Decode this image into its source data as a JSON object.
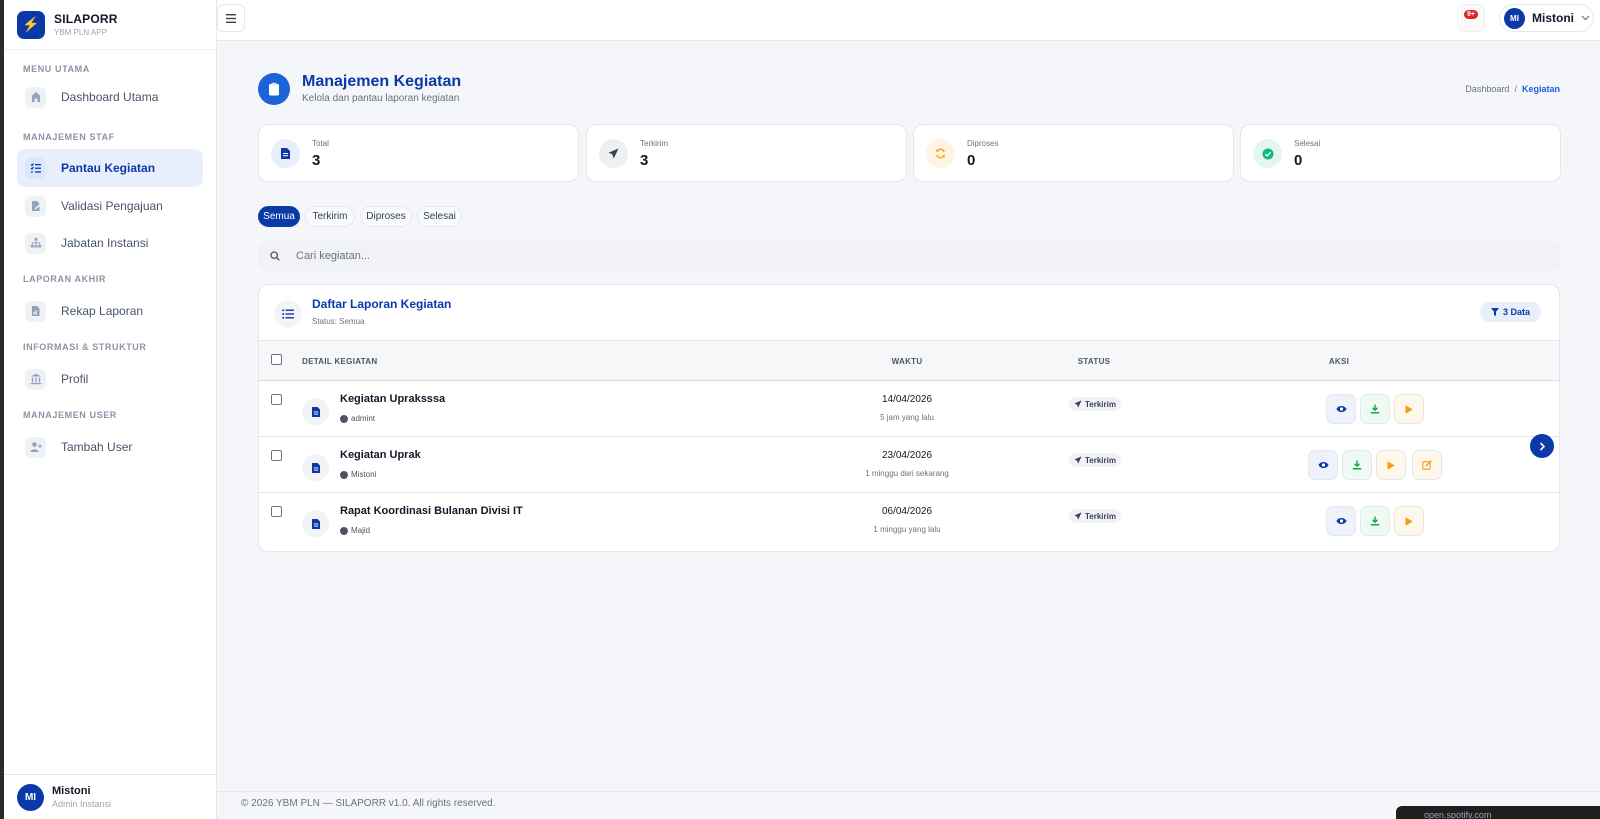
{
  "brand": {
    "title": "SILAPORR",
    "subtitle": "YBM PLN APP"
  },
  "sidebar": {
    "sections": [
      "MENU UTAMA",
      "MANAJEMEN STAF",
      "LAPORAN AKHIR",
      "INFORMASI & STRUKTUR",
      "MANAJEMEN USER"
    ],
    "items": [
      {
        "label": "Dashboard Utama",
        "icon": "home-icon",
        "active": false
      },
      {
        "label": "Pantau Kegiatan",
        "icon": "list-check-icon",
        "active": true
      },
      {
        "label": "Validasi Pengajuan",
        "icon": "file-signature-icon",
        "active": false
      },
      {
        "label": "Jabatan Instansi",
        "icon": "sitemap-icon",
        "active": false
      },
      {
        "label": "Rekap Laporan",
        "icon": "file-chart-icon",
        "active": false
      },
      {
        "label": "Profil",
        "icon": "building-columns-icon",
        "active": false
      },
      {
        "label": "Tambah User",
        "icon": "user-plus-icon",
        "active": false
      }
    ]
  },
  "user": {
    "initials": "MI",
    "name": "Mistoni",
    "role": "Admin Instansi"
  },
  "topbar": {
    "notification_badge": "9+",
    "user_initials": "MI",
    "user_name": "Mistoni"
  },
  "page": {
    "title": "Manajemen Kegiatan",
    "subtitle": "Kelola dan pantau laporan kegiatan",
    "breadcrumb": [
      "Dashboard",
      "Kegiatan"
    ]
  },
  "stats": [
    {
      "label": "Total",
      "value": "3",
      "icon": "file-icon",
      "color": "#0b3aa8"
    },
    {
      "label": "Terkirim",
      "value": "3",
      "icon": "paper-plane-icon",
      "color": "#374151"
    },
    {
      "label": "Diproses",
      "value": "0",
      "icon": "sync-icon",
      "color": "#f59e0b"
    },
    {
      "label": "Selesai",
      "value": "0",
      "icon": "check-circle-icon",
      "color": "#10b981"
    }
  ],
  "tabs": [
    "Semua",
    "Terkirim",
    "Diproses",
    "Selesai"
  ],
  "search": {
    "placeholder": "Cari kegiatan..."
  },
  "table": {
    "title": "Daftar Laporan Kegiatan",
    "subtitle": "Status: Semua",
    "count_label": "3 Data",
    "columns": [
      "DETAIL KEGIATAN",
      "WAKTU",
      "STATUS",
      "AKSI"
    ],
    "rows": [
      {
        "title": "Kegiatan Upraksssa",
        "author": "admint",
        "date": "14/04/2026",
        "relative": "5 jam yang lalu",
        "status": "Terkirim"
      },
      {
        "title": "Kegiatan Uprak",
        "author": "Mistoni",
        "date": "23/04/2026",
        "relative": "1 minggu dari sekarang",
        "status": "Terkirim"
      },
      {
        "title": "Rapat Koordinasi Bulanan Divisi IT",
        "author": "Majid",
        "date": "06/04/2026",
        "relative": "1 minggu yang lalu",
        "status": "Terkirim"
      }
    ]
  },
  "footer": {
    "text": "© 2026 YBM PLN — SILAPORR v1.0. All rights reserved."
  },
  "popup": {
    "text": "open.spotify.com"
  },
  "colors": {
    "primary": "#0b3aa8",
    "accent": "#1d63d8",
    "success": "#10b981",
    "warning": "#f59e0b",
    "danger": "#dc2626"
  }
}
